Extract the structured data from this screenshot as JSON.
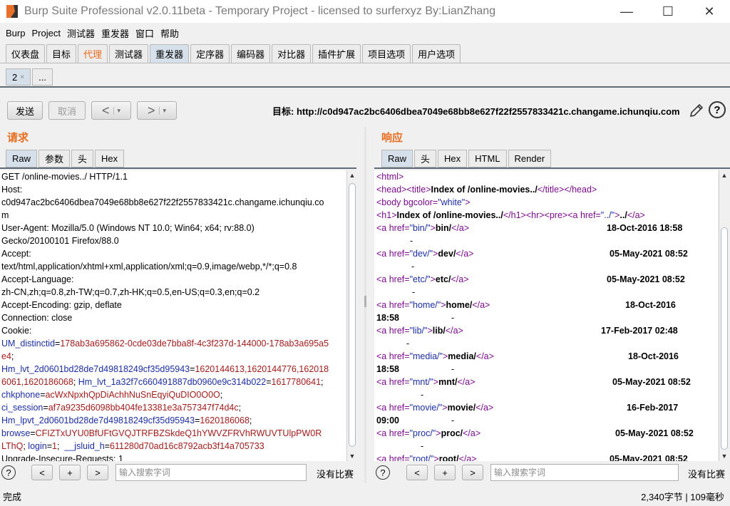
{
  "window": {
    "title": "Burp Suite Professional v2.0.11beta - Temporary Project - licensed to surferxyz By:LianZhang",
    "minimize": "—",
    "maximize": "☐",
    "close": "✕"
  },
  "menu": [
    "Burp",
    "Project",
    "测试器",
    "重发器",
    "窗口",
    "帮助"
  ],
  "main_tabs": [
    {
      "label": "仪表盘"
    },
    {
      "label": "目标"
    },
    {
      "label": "代理"
    },
    {
      "label": "测试器"
    },
    {
      "label": "重发器"
    },
    {
      "label": "定序器"
    },
    {
      "label": "编码器"
    },
    {
      "label": "对比器"
    },
    {
      "label": "插件扩展"
    },
    {
      "label": "项目选项"
    },
    {
      "label": "用户选项"
    }
  ],
  "repeater_tabs": {
    "active": "2",
    "close": "×",
    "more": "..."
  },
  "toolbar": {
    "send": "发送",
    "cancel": "取消",
    "back": "<",
    "forward": ">",
    "dropdown": "▾",
    "target_label": "目标: ",
    "target_url": "http://c0d947ac2bc6406dbea7049e68bb8e627f22f2557833421c.changame.ichunqiu.com",
    "help": "?"
  },
  "request": {
    "title": "请求",
    "tabs": [
      "Raw",
      "参数",
      "头",
      "Hex"
    ],
    "lines": {
      "l1": "GET /online-movies../ HTTP/1.1",
      "l2": "Host:",
      "l3": "c0d947ac2bc6406dbea7049e68bb8e627f22f2557833421c.changame.ichunqiu.co",
      "l4": "m",
      "l5": "User-Agent: Mozilla/5.0 (Windows NT 10.0; Win64; x64; rv:88.0)",
      "l6": "Gecko/20100101 Firefox/88.0",
      "l7": "Accept:",
      "l8": "text/html,application/xhtml+xml,application/xml;q=0.9,image/webp,*/*;q=0.8",
      "l9": "Accept-Language:",
      "l10": "zh-CN,zh;q=0.8,zh-TW;q=0.7,zh-HK;q=0.5,en-US;q=0.3,en;q=0.2",
      "l11": "Accept-Encoding: gzip, deflate",
      "l12": "Connection: close",
      "l13": "Cookie:"
    },
    "cookies": {
      "c1k": "UM_distinctid",
      "c1v": "178ab3a695862-0cde03de7bba8f-4c3f237d-144000-178ab3a695a5",
      "c1b": "e4",
      "c2k": "Hm_lvt_2d0601bd28de7d49818249cf35d95943",
      "c2v": "1620144613,1620144776,162018",
      "c2b": "6061,1620186068",
      "c2ck": "Hm_lvt_1a32f7c660491887db0960e9c314b022",
      "c2cv": "1617780641",
      "c3k": "chkphone",
      "c3v": "acWxNpxhQpDiAchhNuSnEqyiQuDIO0O0O",
      "c4k": "ci_session",
      "c4v": "af7a9235d6098bb404fe13381e3a757347f74d4c",
      "c5k": "Hm_lpvt_2d0601bd28de7d49818249cf35d95943",
      "c5v": "1620186068",
      "c6k": "browse",
      "c6v": "CFIZTxUYU0BfUFtGVQJTRFBZSkdeQ1hYWVZFRVhRWUVTUlpPW0R",
      "c6b": "LThQ",
      "c7k": "login",
      "c7v": "1",
      "c8k": "__jsluid_h",
      "c8v": "611280d70ad16c8792acb3f14a705733",
      "last": "Upgrade-Insecure-Requests: 1"
    },
    "search_placeholder": "输入搜索字词",
    "no_match": "没有比赛"
  },
  "response": {
    "title": "响应",
    "tabs": [
      "Raw",
      "头",
      "Hex",
      "HTML",
      "Render"
    ],
    "rows": [
      {
        "href": "bin/",
        "name": "bin/",
        "date": "18-Oct-2016 18:58",
        "dash": "-"
      },
      {
        "href": "dev/",
        "name": "dev/",
        "date": "05-May-2021 08:52",
        "dash": "-"
      },
      {
        "href": "etc/",
        "name": "etc/",
        "date": "05-May-2021 08:52",
        "dash": "-"
      },
      {
        "href": "home/",
        "name": "home/",
        "date": "18-Oct-2016",
        "date2": "18:58",
        "dash": "-"
      },
      {
        "href": "lib/",
        "name": "lib/",
        "date": "17-Feb-2017 02:48",
        "dash": "-"
      },
      {
        "href": "media/",
        "name": "media/",
        "date": "18-Oct-2016",
        "date2": "18:58",
        "dash": "-"
      },
      {
        "href": "mnt/",
        "name": "mnt/",
        "date": "05-May-2021 08:52",
        "dash": "-"
      },
      {
        "href": "movie/",
        "name": "movie/",
        "date": "16-Feb-2017",
        "date2": "09:00",
        "dash": "-"
      },
      {
        "href": "proc/",
        "name": "proc/",
        "date": "05-May-2021 08:52",
        "dash": "-"
      },
      {
        "href": "root/",
        "name": "root/",
        "date": "05-May-2021 08:52"
      }
    ],
    "head_title": "Index of /online-movies../",
    "h1_text": "Index of /online-movies../",
    "parent": "../",
    "bgcolor": "\"white\"",
    "search_placeholder": "输入搜索字词",
    "no_match": "没有比赛"
  },
  "status": {
    "left": "完成",
    "right": "2,340字节 | 109毫秒"
  },
  "search_buttons": {
    "help": "?",
    "prev": "<",
    "add": "+",
    "next": ">"
  }
}
